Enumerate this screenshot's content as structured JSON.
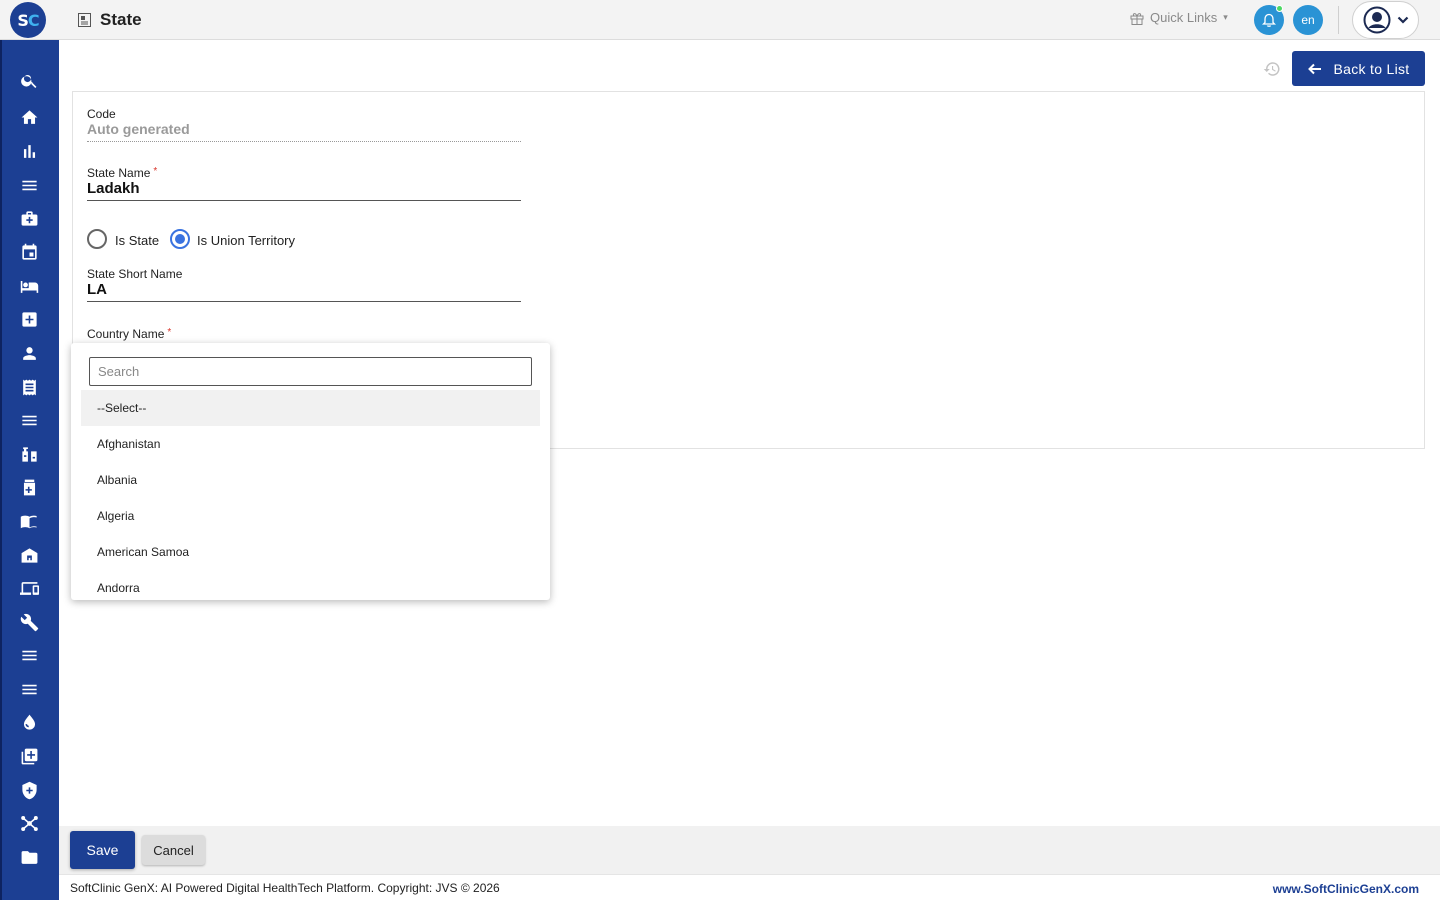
{
  "header": {
    "logo_text_s": "S",
    "logo_text_c": "C",
    "page_title": "State",
    "quick_links_label": "Quick Links",
    "language": "en"
  },
  "sidebar": {
    "items": [
      {
        "name": "search-icon"
      },
      {
        "name": "home-icon"
      },
      {
        "name": "bar-chart-icon"
      },
      {
        "name": "menu-icon"
      },
      {
        "name": "medical-kit-icon"
      },
      {
        "name": "calendar-icon"
      },
      {
        "name": "bed-icon"
      },
      {
        "name": "medical-cross-icon"
      },
      {
        "name": "person-icon"
      },
      {
        "name": "receipt-icon"
      },
      {
        "name": "menu-icon"
      },
      {
        "name": "pharmacy-icon"
      },
      {
        "name": "medicine-icon"
      },
      {
        "name": "book-icon"
      },
      {
        "name": "hospital-icon"
      },
      {
        "name": "devices-icon"
      },
      {
        "name": "wrench-icon"
      },
      {
        "name": "menu-icon"
      },
      {
        "name": "menu-icon"
      },
      {
        "name": "blood-drop-icon"
      },
      {
        "name": "add-library-icon"
      },
      {
        "name": "shield-icon"
      },
      {
        "name": "network-icon"
      },
      {
        "name": "folder-icon"
      }
    ]
  },
  "toolbar": {
    "back_label": "Back to List"
  },
  "form": {
    "code_label": "Code",
    "code_value": "Auto generated",
    "state_name_label": "State Name",
    "state_name_required": "*",
    "state_name_value": "Ladakh",
    "radio_state_label": "Is State",
    "radio_ut_label": "Is Union Territory",
    "radio_selected": "Is Union Territory",
    "short_name_label": "State Short Name",
    "short_name_value": "LA",
    "country_label": "Country Name",
    "country_required": "*"
  },
  "dropdown": {
    "search_placeholder": "Search",
    "options": [
      "--Select--",
      "Afghanistan",
      "Albania",
      "Algeria",
      "American Samoa",
      "Andorra"
    ],
    "selected": "--Select--"
  },
  "actions": {
    "save_label": "Save",
    "cancel_label": "Cancel"
  },
  "footer": {
    "copyright": "SoftClinic GenX: AI Powered Digital HealthTech Platform. Copyright: JVS © 2026",
    "website": "www.SoftClinicGenX.com"
  },
  "colors": {
    "primary": "#1c3f93",
    "accent": "#2a93d5",
    "radio_checked": "#3a73e0",
    "required": "#d9352b"
  }
}
